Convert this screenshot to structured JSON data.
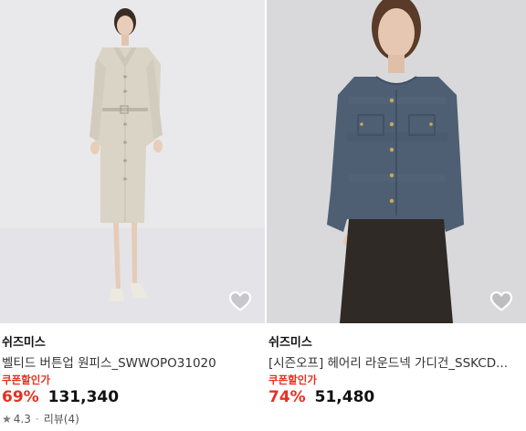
{
  "products": [
    {
      "brand": "쉬즈미스",
      "title": "벨티드 버튼업 원피스_SWWOPO31020",
      "coupon_label": "쿠폰할인가",
      "discount": "69%",
      "price": "131,340",
      "rating": "4.3",
      "review_label": "리뷰(4)",
      "image_icon": "dress-photo",
      "wishlist_icon": "heart-outline-icon"
    },
    {
      "brand": "쉬즈미스",
      "title": "[시즌오프] 헤어리 라운드넥 가디건_SSKCD...",
      "coupon_label": "쿠폰할인가",
      "discount": "74%",
      "price": "51,480",
      "image_icon": "cardigan-photo",
      "wishlist_icon": "heart-outline-icon"
    }
  ],
  "colors": {
    "accent_red": "#e5301f",
    "left_bg": "#e9e9ec",
    "right_bg": "#d9d9db"
  }
}
